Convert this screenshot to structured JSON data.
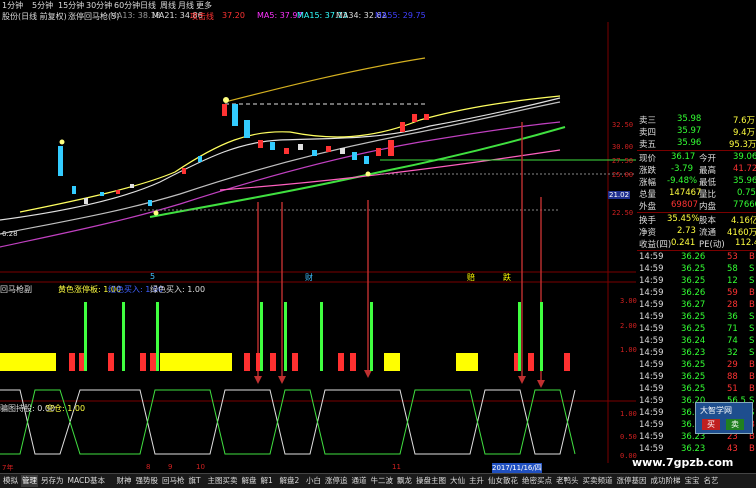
{
  "topbar": {
    "periods": [
      "1分钟",
      "5分钟",
      "15分钟",
      "30分钟",
      "60分钟",
      "日线",
      "周线",
      "月线",
      "更多"
    ]
  },
  "main_info": {
    "title": "股份(日线 前复权)",
    "indicator": "涨停回马枪(5)",
    "ma13": "MA13: 38.18",
    "ma21": "MA21: 34.86",
    "tag": "攻击线",
    "tag_val": "37.20",
    "ma5": "MA5: 37.97",
    "ma15": "MA15: 37.13",
    "ma34": "MA34: 32.62",
    "ma55": "MA55: 29.75"
  },
  "main_axis": [
    "32.50",
    "30.00",
    "27.50",
    "25.00",
    "22.50"
  ],
  "price_low_label": "6.28",
  "current_price_tag": "21.02",
  "sub1": {
    "legend_a": "黄色涨停板: 1.00",
    "legend_b": "红色买入: 1.00",
    "legend_c": "绿色买入: 1.00",
    "name": "回马枪副",
    "axis": [
      "3.00",
      "2.00",
      "1.00"
    ]
  },
  "sub2": {
    "name": "骗图",
    "legend_a": "持股: 0.00",
    "legend_b": "空仓: 1.00",
    "axis": [
      "1.00",
      "0.50",
      "0.00"
    ]
  },
  "markers": {
    "dot1": "5",
    "dot2": "财",
    "dot3": "赔",
    "dot4": "跌"
  },
  "quote": {
    "sell3": {
      "label": "卖三",
      "price": "35.98",
      "vol": "7.6万"
    },
    "sell4": {
      "label": "卖四",
      "price": "35.97",
      "vol": "9.4万"
    },
    "sell5": {
      "label": "卖五",
      "price": "35.96",
      "vol": "95.3万"
    },
    "now": {
      "l1": "现价",
      "v1": "36.17",
      "l2": "今开",
      "v2": "39.06"
    },
    "chg": {
      "l1": "涨跌",
      "v1": "-3.79",
      "l2": "最高",
      "v2": "41.72"
    },
    "pct": {
      "l1": "涨幅",
      "v1": "-9.48%",
      "l2": "最低",
      "v2": "35.96"
    },
    "total": {
      "l1": "总量",
      "v1": "147467",
      "l2": "量比",
      "v2": "0.75"
    },
    "outer": {
      "l1": "外盘",
      "v1": "69807",
      "l2": "内盘",
      "v2": "77660"
    },
    "turnover": {
      "l1": "换手",
      "v1": "35.45%",
      "l2": "股本",
      "v2": "4.16亿"
    },
    "net": {
      "l1": "净资",
      "v1": "2.73",
      "l2": "流通",
      "v2": "4160万"
    },
    "income": {
      "l1": "收益(四)",
      "v1": "0.241",
      "l2": "PE(动)",
      "v2": "112.4"
    }
  },
  "ticks": [
    {
      "t": "14:59",
      "p": "36.26",
      "v": "53",
      "s": "B"
    },
    {
      "t": "14:59",
      "p": "36.25",
      "v": "58",
      "s": "S"
    },
    {
      "t": "14:59",
      "p": "36.25",
      "v": "12",
      "s": "S"
    },
    {
      "t": "14:59",
      "p": "36.26",
      "v": "59",
      "s": "B"
    },
    {
      "t": "14:59",
      "p": "36.27",
      "v": "28",
      "s": "B"
    },
    {
      "t": "14:59",
      "p": "36.25",
      "v": "36",
      "s": "S"
    },
    {
      "t": "14:59",
      "p": "36.25",
      "v": "71",
      "s": "S"
    },
    {
      "t": "14:59",
      "p": "36.24",
      "v": "74",
      "s": "S"
    },
    {
      "t": "14:59",
      "p": "36.23",
      "v": "32",
      "s": "S"
    },
    {
      "t": "14:59",
      "p": "36.25",
      "v": "29",
      "s": "B"
    },
    {
      "t": "14:59",
      "p": "36.25",
      "v": "88",
      "s": "B"
    },
    {
      "t": "14:59",
      "p": "36.25",
      "v": "51",
      "s": "B"
    },
    {
      "t": "14:59",
      "p": "36.20",
      "v": "56.5",
      "s": "S"
    },
    {
      "t": "14:59",
      "p": "36.10",
      "v": "84",
      "s": "S"
    },
    {
      "t": "14:59",
      "p": "36.20",
      "v": "24",
      "s": "B"
    },
    {
      "t": "14:59",
      "p": "36.23",
      "v": "23",
      "s": "B"
    },
    {
      "t": "14:59",
      "p": "36.23",
      "v": "43",
      "s": "B"
    }
  ],
  "date_bar": {
    "d1": "7年",
    "d2": "8",
    "d3": "9",
    "d4": "10",
    "d5": "11",
    "date": "2017/11/16/四"
  },
  "popup": {
    "title": "大智学网",
    "btn1": "买",
    "btn2": "卖"
  },
  "watermark": "www.7gpzb.com",
  "tabs": [
    "模拟",
    "管理",
    "另存为",
    "MACD基本",
    "财神",
    "强势股",
    "回马枪",
    "旗T",
    "主图买卖",
    "解盘",
    "解1",
    "解盘2",
    "小白",
    "涨停追",
    "通道",
    "牛二波",
    "飘龙",
    "操盘主图",
    "大仙",
    "主升",
    "仙女散花",
    "绝密买点",
    "老鸭头",
    "买卖频道",
    "涨停基因",
    "成功阶梯",
    "宝宝",
    "名艺"
  ]
}
